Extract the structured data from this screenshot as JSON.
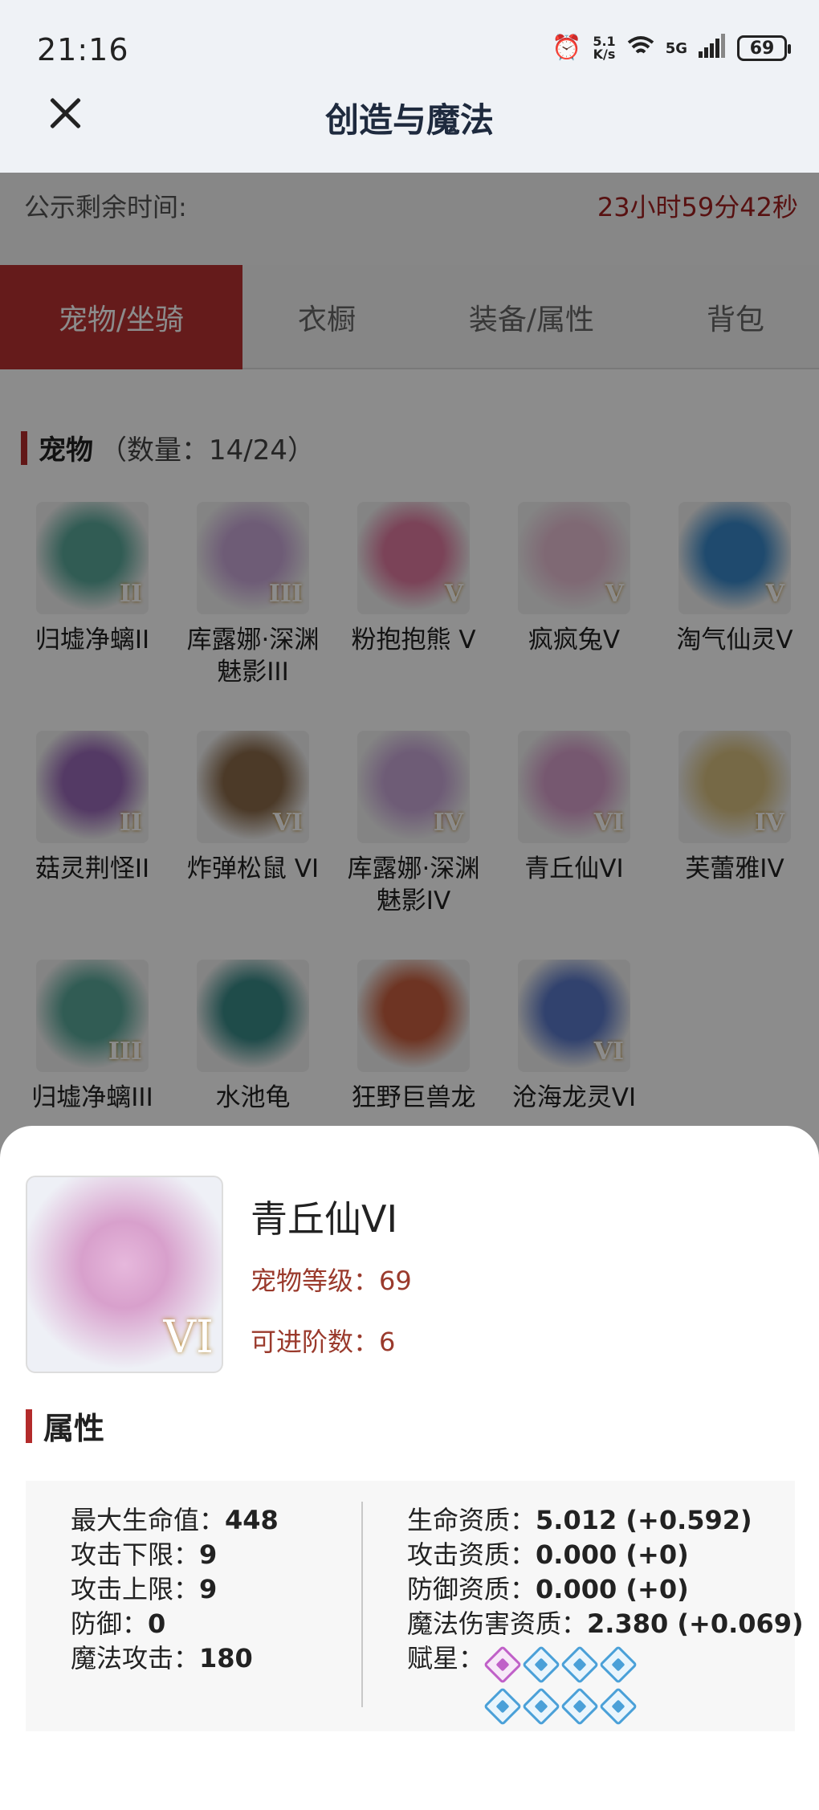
{
  "status_bar": {
    "time": "21:16",
    "speed_top": "5.1",
    "speed_bottom": "K/s",
    "network": "5G",
    "battery": "69"
  },
  "header": {
    "title": "创造与魔法"
  },
  "timer": {
    "label": "公示剩余时间:",
    "value": "23小时59分42秒"
  },
  "tabs": [
    {
      "label": "宠物/坐骑",
      "active": true
    },
    {
      "label": "衣橱",
      "active": false
    },
    {
      "label": "装备/属性",
      "active": false
    },
    {
      "label": "背包",
      "active": false
    }
  ],
  "pets_section": {
    "title": "宠物",
    "count": "（数量：14/24）"
  },
  "pets": [
    {
      "name": "归墟净螭II",
      "badge": "II",
      "color": "#5aa89a"
    },
    {
      "name": "库露娜·深渊魅影III",
      "badge": "III",
      "color": "#c9a8d8"
    },
    {
      "name": "粉抱抱熊 V",
      "badge": "V",
      "color": "#e07aa0"
    },
    {
      "name": "疯疯兔V",
      "badge": "V",
      "color": "#e8c0d4"
    },
    {
      "name": "淘气仙灵V",
      "badge": "V",
      "color": "#3a88c8"
    },
    {
      "name": "菇灵荆怪II",
      "badge": "II",
      "color": "#9a6ab8"
    },
    {
      "name": "炸弹松鼠 VI",
      "badge": "VI",
      "color": "#8a6a4a"
    },
    {
      "name": "库露娜·深渊魅影IV",
      "badge": "IV",
      "color": "#c9a8d8"
    },
    {
      "name": "青丘仙VI",
      "badge": "VI",
      "color": "#d8a0cc"
    },
    {
      "name": "芙蕾雅IV",
      "badge": "IV",
      "color": "#d8c080"
    },
    {
      "name": "归墟净螭III",
      "badge": "III",
      "color": "#5aa89a"
    },
    {
      "name": "水池龟",
      "badge": "",
      "color": "#3a8a88"
    },
    {
      "name": "狂野巨兽龙",
      "badge": "",
      "color": "#c86040"
    },
    {
      "name": "沧海龙灵VI",
      "badge": "VI",
      "color": "#5a78c8"
    }
  ],
  "detail": {
    "name": "青丘仙VI",
    "badge": "VI",
    "level": "宠物等级：69",
    "advance": "可进阶数：6",
    "attr_title": "属性",
    "left_stats": [
      {
        "label": "最大生命值：",
        "value": "448"
      },
      {
        "label": "攻击下限：",
        "value": "9"
      },
      {
        "label": "攻击上限：",
        "value": "9"
      },
      {
        "label": "防御：",
        "value": "0"
      },
      {
        "label": "魔法攻击：",
        "value": "180"
      }
    ],
    "right_stats": [
      {
        "label": "生命资质：",
        "value": "5.012 (+0.592)"
      },
      {
        "label": "攻击资质：",
        "value": "0.000 (+0)"
      },
      {
        "label": "防御资质：",
        "value": "0.000 (+0)"
      },
      {
        "label": "魔法伤害资质：",
        "value": "2.380 (+0.069)"
      }
    ],
    "stars_label": "赋星：",
    "stars": [
      "purple",
      "blue",
      "blue",
      "blue",
      "blue",
      "blue",
      "blue",
      "blue"
    ]
  }
}
